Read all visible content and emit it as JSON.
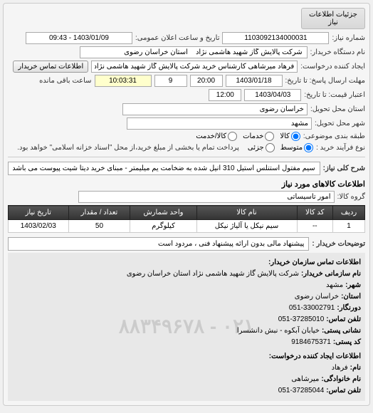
{
  "panel": {
    "title": "جزئیات اطلاعات نیاز"
  },
  "header": {
    "need_no_label": "شماره نیاز:",
    "need_no": "1103092134000031",
    "announce_label": "تاریخ و ساعت اعلان عمومی:",
    "announce_value": "1403/01/09 - 09:43",
    "buyer_org_label": "نام دستگاه خریدار:",
    "buyer_org": "شرکت پالایش گاز شهید هاشمی نژاد    استان خراسان رضوی",
    "requester_label": "ایجاد کننده درخواست:",
    "requester": "فرهاد میرشاهی کارشناس خرید شرکت پالایش گاز شهید هاشمی نژاد    استا",
    "contact_btn": "اطلاعات تماس خریدار",
    "deadline_label": "مهلت ارسال پاسخ: تا تاریخ:",
    "deadline_date": "1403/01/18",
    "deadline_time": "20:00",
    "remain_days": "9",
    "remain_time": "10:03:31",
    "remain_label": "ساعت باقی مانده",
    "validity_label": "اعتبار قیمت: تا تاریخ:",
    "validity_date": "1403/04/03",
    "validity_time": "12:00",
    "province_label": "استان محل تحویل:",
    "province": "خراسان رضوی",
    "city_label": "شهر محل تحویل:",
    "city": "مشهد",
    "subject_type_label": "طبقه بندی موضوعی:",
    "radios": {
      "kala": "کالا",
      "khadamat": "خدمات",
      "both": "کالا/خدمت"
    },
    "buy_type_label": "نوع فرآیند خرید :",
    "radios2": {
      "mid": "متوسط",
      "small": "جزئی"
    },
    "buy_note": "پرداخت تمام یا بخشی از مبلغ خرید،از محل \"اسناد خزانه اسلامی\" خواهد بود."
  },
  "need": {
    "title_label": "شرح کلی نیاز:",
    "title_value": "سیم مفتول استنلس استیل 310 آنیل شده به ضخامت یم میلیمتر - مبنای خرید دیتا شیت پیوست می باشد",
    "goods_section": "اطلاعات کالاهای مورد نیاز",
    "group_label": "گروه کالا:",
    "group_value": "امور تاسیساتی"
  },
  "table": {
    "headers": [
      "ردیف",
      "کد کالا",
      "نام کالا",
      "واحد شمارش",
      "تعداد / مقدار",
      "تاریخ نیاز"
    ],
    "rows": [
      {
        "idx": "1",
        "code": "--",
        "name": "سیم نیکل یا آلیاژ نیکل",
        "unit": "کیلوگرم",
        "qty": "50",
        "date": "1403/02/03"
      }
    ]
  },
  "notes": {
    "label": "توضیحات خریدار :",
    "value": "پیشنهاد مالی بدون ارائه پیشنهاد فنی ، مردود است"
  },
  "contact": {
    "section": "اطلاعات تماس سازمان خریدار:",
    "org_label": "نام سازمانی خریدار:",
    "org": "شرکت پالایش گاز شهید هاشمی نژاد استان خراسان رضوی",
    "city_label": "شهر:",
    "city": "مشهد",
    "province_label": "استان:",
    "province": "خراسان رضوی",
    "fax_label": "دورنگار:",
    "fax": "051-33002791",
    "tel_label": "تلفن تماس:",
    "tel": "051-37285010",
    "postal_label": "نشانی پستی:",
    "postal": "خیابان آبکوه - نبش دانشسرا",
    "zip_label": "کد پستی:",
    "zip": "9184675371",
    "req_section": "اطلاعات ایجاد کننده درخواست:",
    "name_label": "نام:",
    "name": "فرهاد",
    "lname_label": "نام خانوادگی:",
    "lname": "میرشاهی",
    "rtel_label": "تلفن تماس:",
    "rtel": "051-37285044",
    "watermark": "۰۲۱ - ۸۸۳۴۹۶۷۸"
  }
}
